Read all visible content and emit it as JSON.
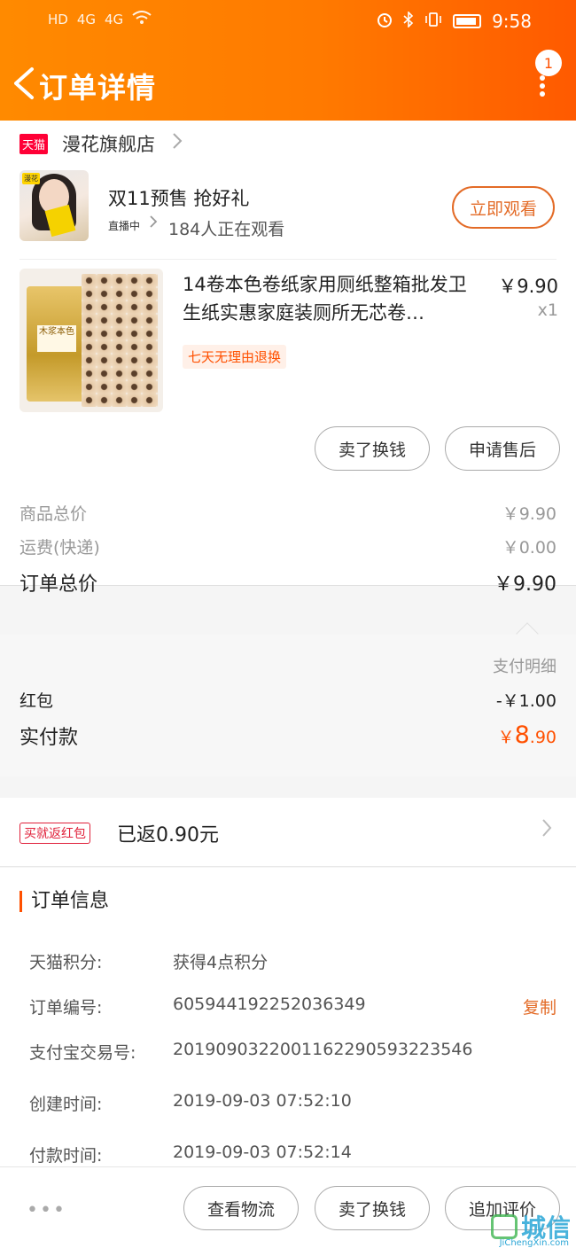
{
  "status_bar": {
    "left": [
      "HD",
      "4G",
      "4G"
    ],
    "time": "9:58"
  },
  "header": {
    "title": "订单详情",
    "badge_count": "1"
  },
  "store": {
    "platform_badge": "天猫",
    "name": "漫花旗舰店"
  },
  "live": {
    "avatar_tag": "漫花",
    "title": "双11预售 抢好礼",
    "status": "直播中",
    "viewers": "184人正在观看",
    "watch_button": "立即观看"
  },
  "product": {
    "package_text": "木浆本色",
    "name": "14卷本色卷纸家用厕纸整箱批发卫生纸实惠家庭装厕所无芯卷…",
    "price": "￥9.90",
    "quantity": "x1",
    "refund_tag": "七天无理由退换",
    "buttons": [
      "卖了换钱",
      "申请售后"
    ]
  },
  "summary": {
    "goods_total_label": "商品总价",
    "goods_total": "￥9.90",
    "shipping_label": "运费(快递)",
    "shipping": "￥0.00",
    "order_total_label": "订单总价",
    "order_total": "￥9.90"
  },
  "payment": {
    "detail_label": "支付明细",
    "redpacket_label": "红包",
    "redpacket_value": "-￥1.00",
    "paid_label": "实付款",
    "paid_symbol": "￥",
    "paid_int": "8",
    "paid_dec": ".90"
  },
  "rebate": {
    "tag": "买就返红包",
    "text": "已返0.90元"
  },
  "order_info": {
    "title": "订单信息",
    "points_label": "天猫积分:",
    "points_value": "获得4点积分",
    "order_no_label": "订单编号:",
    "order_no": "605944192252036349",
    "copy": "复制",
    "alipay_label": "支付宝交易号:",
    "alipay_no": "2019090322001162290593223546",
    "created_label": "创建时间:",
    "created": "2019-09-03 07:52:10",
    "paid_time_label": "付款时间:",
    "paid_time": "2019-09-03 07:52:14"
  },
  "bottom_bar": {
    "more": "•••",
    "buttons": [
      "查看物流",
      "卖了换钱",
      "追加评价"
    ]
  },
  "watermark": {
    "text": "城信",
    "sub": "JiChengXin.com"
  },
  "colors": {
    "header_orange": "#ff7a00",
    "accent": "#ff5000",
    "tmall_red": "#ff0036"
  }
}
